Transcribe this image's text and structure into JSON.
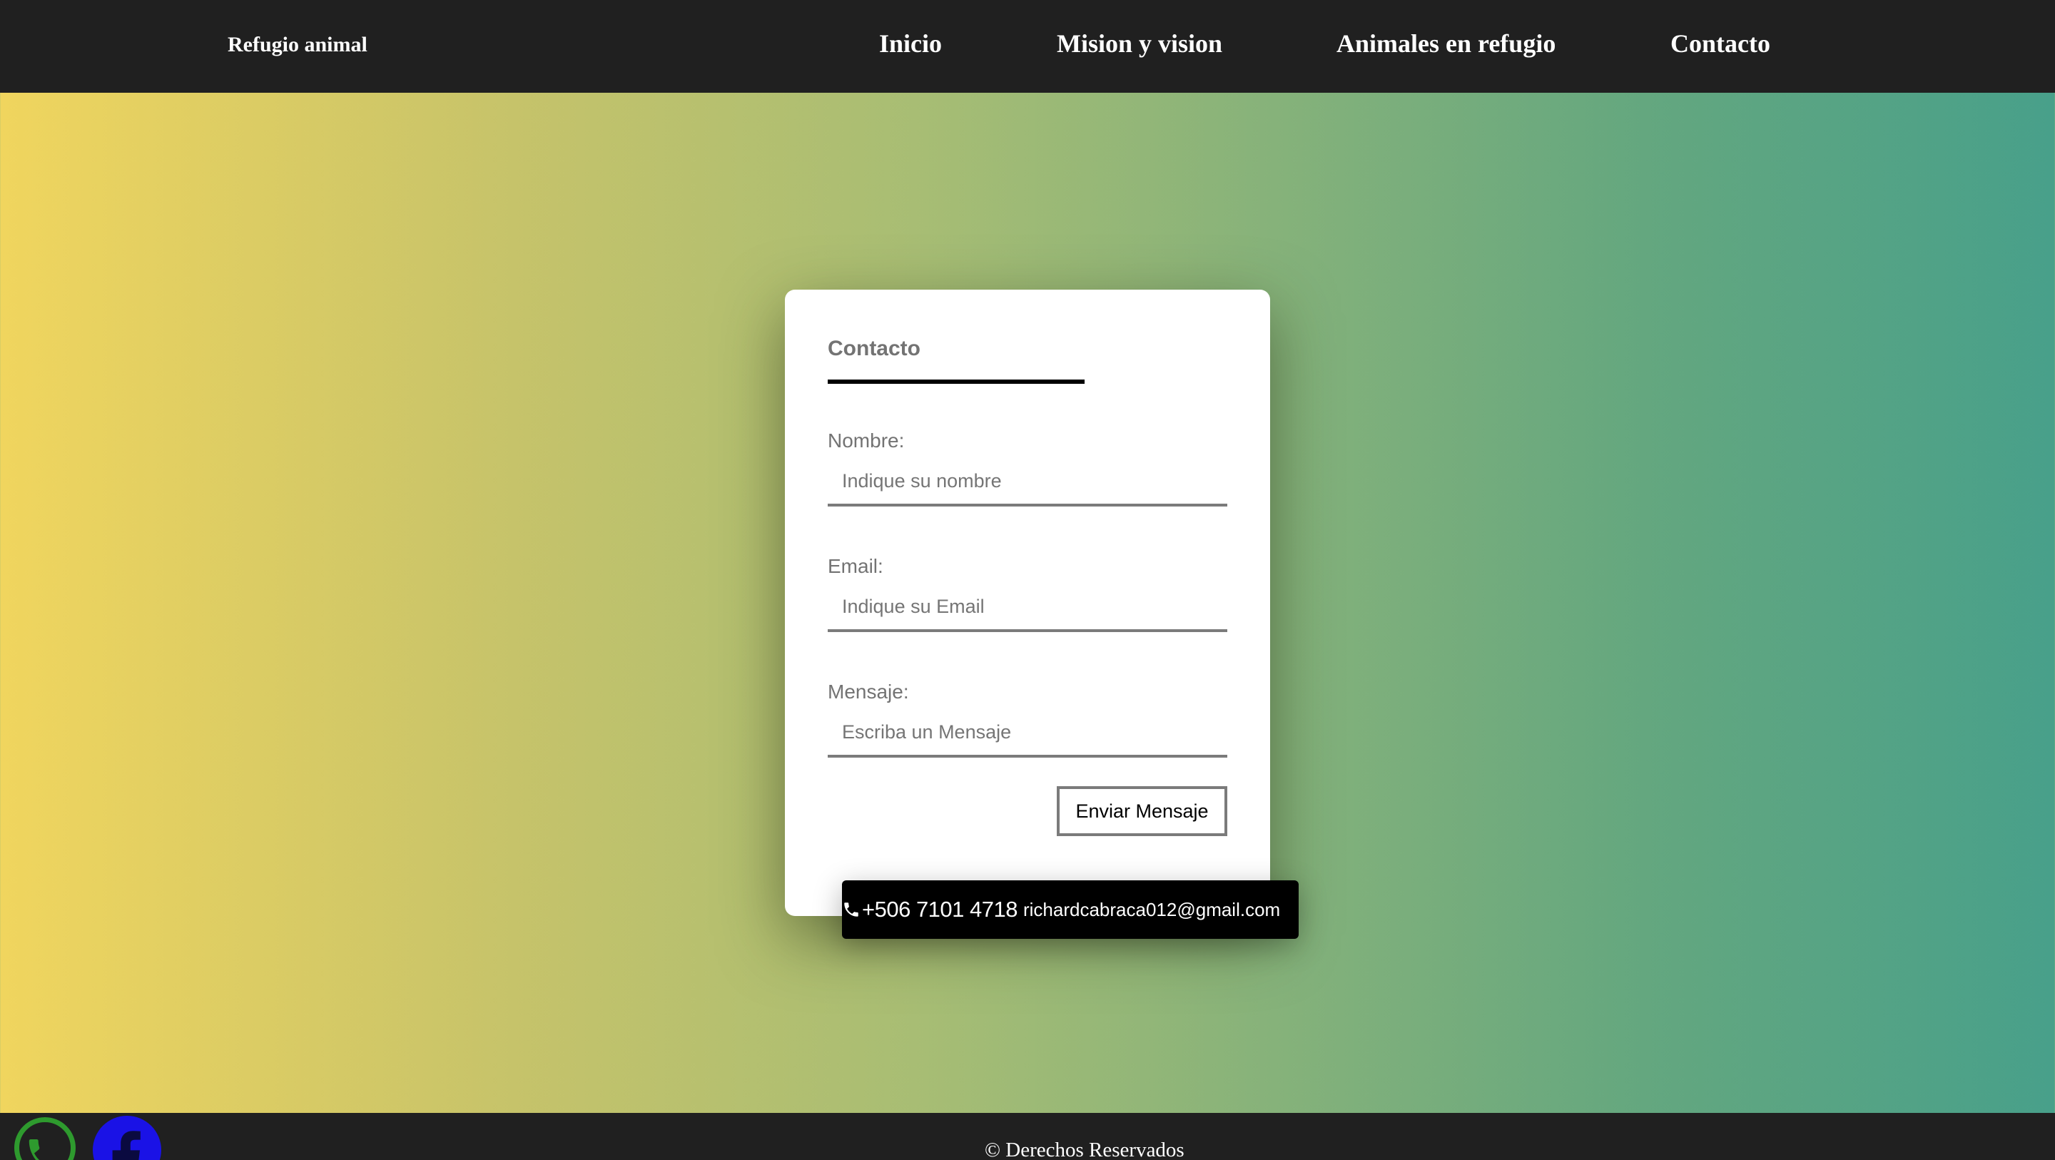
{
  "navbar": {
    "brand": "Refugio animal",
    "links": [
      "Inicio",
      "Mision y vision",
      "Animales en refugio",
      "Contacto"
    ]
  },
  "form": {
    "title": "Contacto",
    "fields": [
      {
        "label": "Nombre:",
        "placeholder": "Indique su nombre"
      },
      {
        "label": "Email:",
        "placeholder": "Indique su Email"
      },
      {
        "label": "Mensaje:",
        "placeholder": "Escriba un Mensaje"
      }
    ],
    "submit_label": "Enviar Mensaje"
  },
  "contact_bar": {
    "phone": "+506 7101 4718",
    "email": "richardcabraca012@gmail.com",
    "icon": "phone-icon"
  },
  "footer": {
    "copyright": "© Derechos Reservados",
    "social_icons": [
      "whatsapp-icon",
      "facebook-icon"
    ]
  },
  "colors": {
    "navbar_bg": "#202020",
    "gradient_start": "#f0d55e",
    "gradient_end": "#48a08a",
    "whatsapp": "#2e9a2e",
    "facebook": "#1a12e6"
  }
}
